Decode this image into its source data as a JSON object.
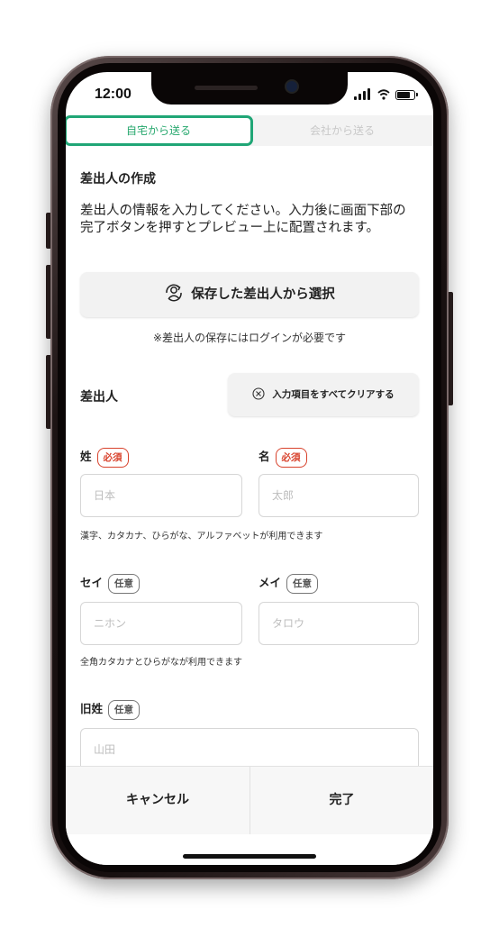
{
  "status_bar": {
    "time": "12:00"
  },
  "tabs": {
    "home": "自宅から送る",
    "company": "会社から送る"
  },
  "form": {
    "title": "差出人の作成",
    "description": "差出人の情報を入力してください。入力後に画面下部の完了ボタンを押すとプレビュー上に配置されます。",
    "saved_button": "保存した差出人から選択",
    "login_note": "※差出人の保存にはログインが必要です",
    "sender_label": "差出人",
    "clear_button": "入力項目をすべてクリアする",
    "fields": {
      "last_name": {
        "label": "姓",
        "badge": "必須",
        "placeholder": "日本"
      },
      "first_name": {
        "label": "名",
        "badge": "必須",
        "placeholder": "太郎"
      },
      "name_hint": "漢字、カタカナ、ひらがな、アルファベットが利用できます",
      "last_kana": {
        "label": "セイ",
        "badge": "任意",
        "placeholder": "ニホン"
      },
      "first_kana": {
        "label": "メイ",
        "badge": "任意",
        "placeholder": "タロウ"
      },
      "kana_hint": "全角カタカナとひらがなが利用できます",
      "maiden_name": {
        "label": "旧姓",
        "badge": "任意",
        "placeholder": "山田"
      }
    }
  },
  "footer": {
    "cancel": "キャンセル",
    "done": "完了"
  },
  "colors": {
    "accent": "#20a676",
    "required": "#d8422c"
  }
}
